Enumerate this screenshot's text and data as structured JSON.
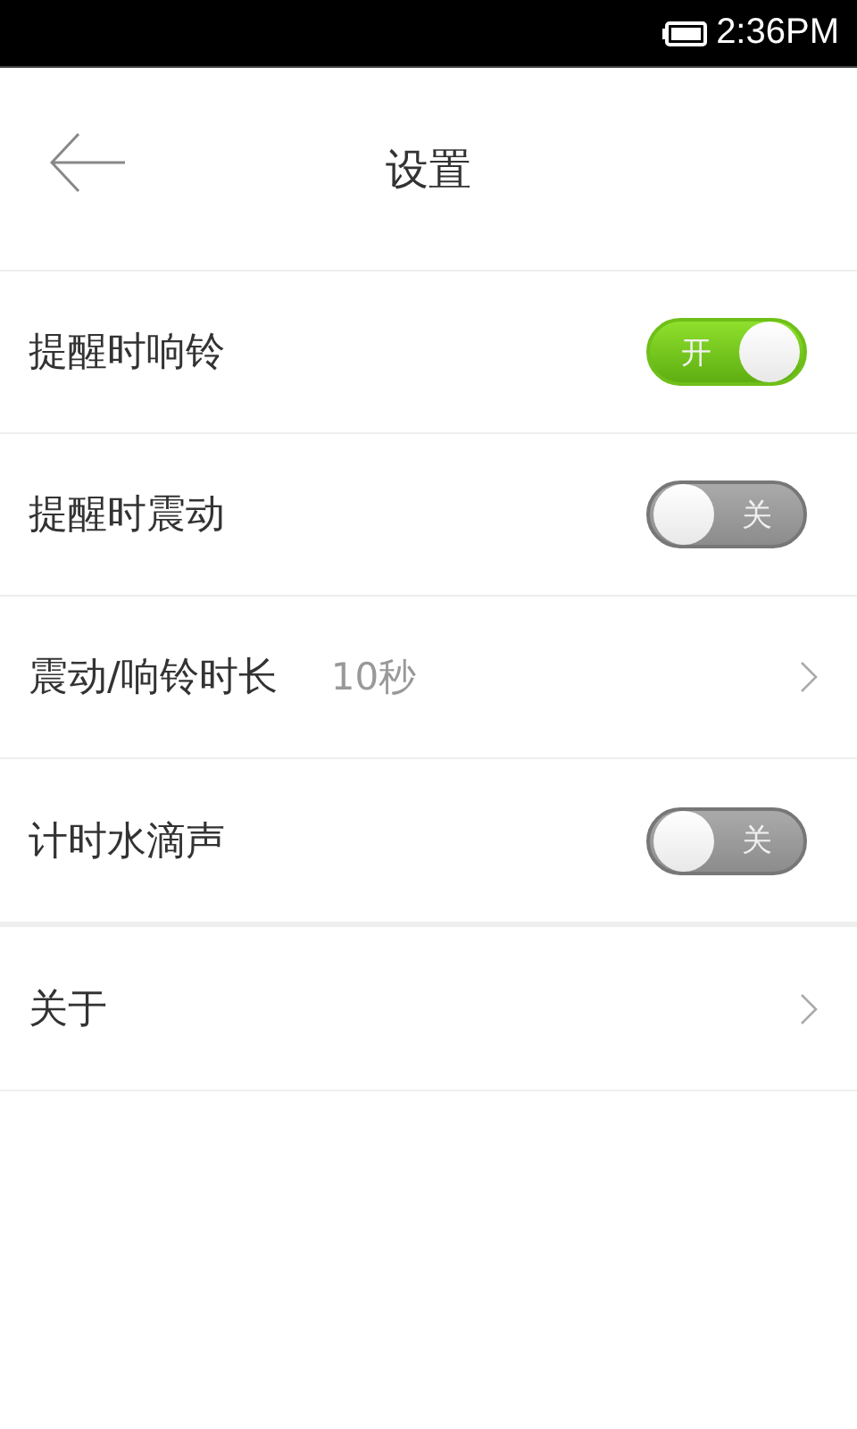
{
  "status_bar": {
    "time": "2:36PM"
  },
  "header": {
    "title": "设置"
  },
  "groups": [
    {
      "items": [
        {
          "kind": "toggle",
          "label": "提醒时响铃",
          "on": true,
          "switch_text": "开"
        },
        {
          "kind": "toggle",
          "label": "提醒时震动",
          "on": false,
          "switch_text": "关"
        },
        {
          "kind": "link",
          "label": "震动/响铃时长",
          "value": "10秒"
        },
        {
          "kind": "toggle",
          "label": "计时水滴声",
          "on": false,
          "switch_text": "关"
        }
      ]
    },
    {
      "items": [
        {
          "kind": "link",
          "label": "关于"
        }
      ]
    }
  ]
}
